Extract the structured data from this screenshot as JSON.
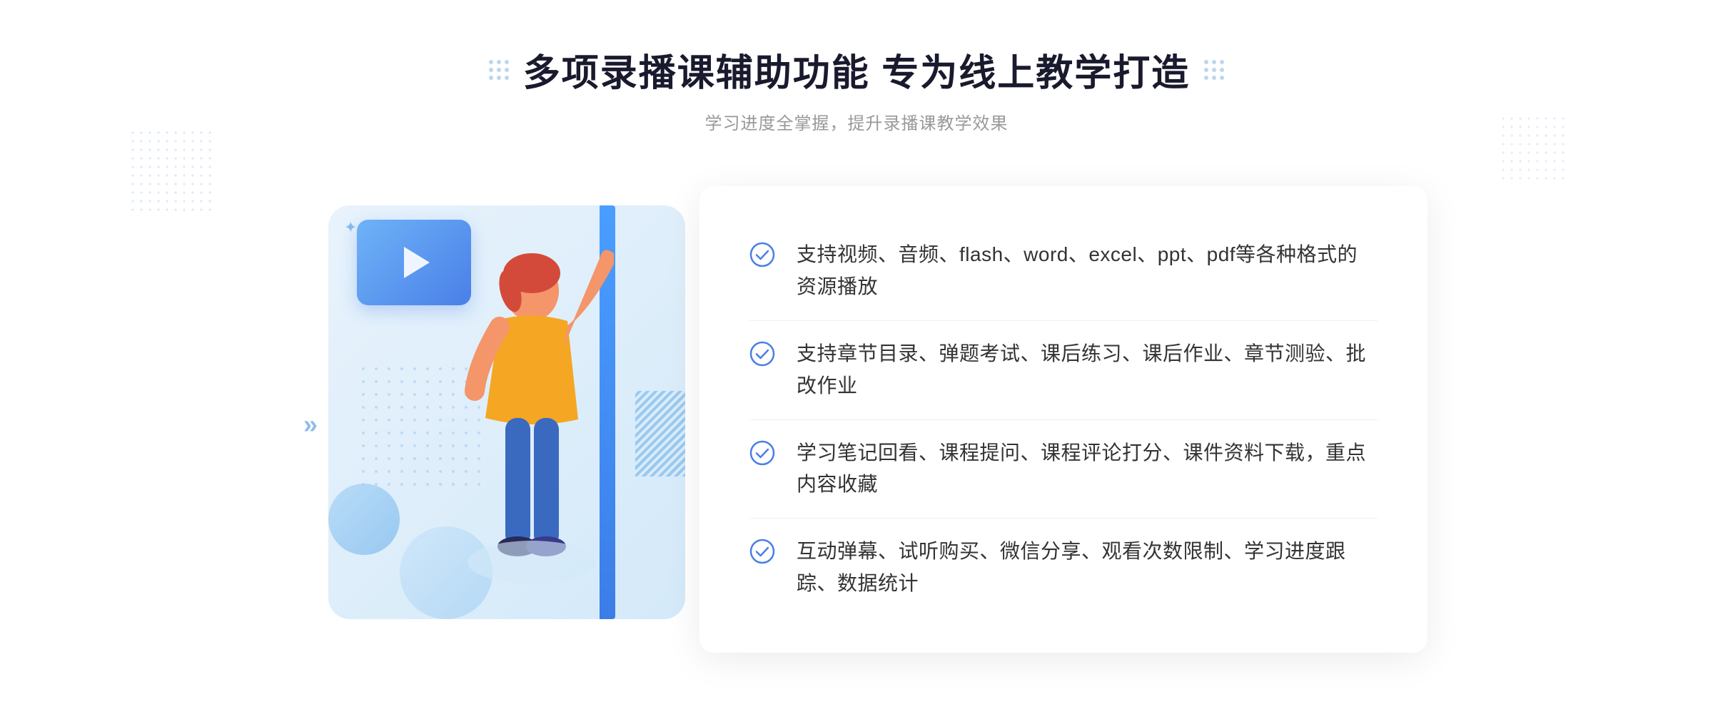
{
  "header": {
    "title": "多项录播课辅助功能 专为线上教学打造",
    "subtitle": "学习进度全掌握，提升录播课教学效果"
  },
  "features": [
    {
      "id": 1,
      "text": "支持视频、音频、flash、word、excel、ppt、pdf等各种格式的资源播放"
    },
    {
      "id": 2,
      "text": "支持章节目录、弹题考试、课后练习、课后作业、章节测验、批改作业"
    },
    {
      "id": 3,
      "text": "学习笔记回看、课程提问、课程评论打分、课件资料下载，重点内容收藏"
    },
    {
      "id": 4,
      "text": "互动弹幕、试听购买、微信分享、观看次数限制、学习进度跟踪、数据统计"
    }
  ],
  "icons": {
    "check_circle": "check-circle-icon",
    "chevron_right": "»",
    "play": "play-icon"
  },
  "colors": {
    "accent": "#4a7fe8",
    "accent_light": "#6eb3f7",
    "text_primary": "#333333",
    "text_secondary": "#999999",
    "title_color": "#1a1a2e"
  }
}
